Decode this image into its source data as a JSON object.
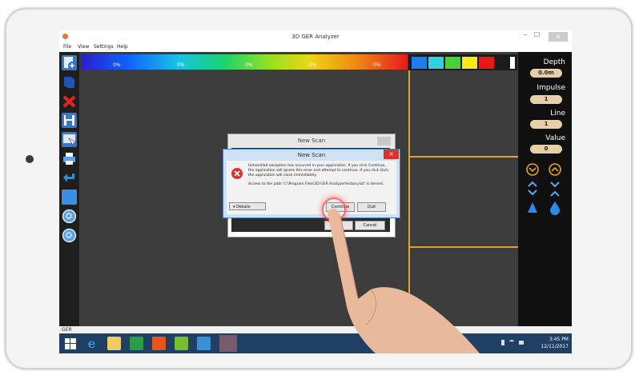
{
  "window": {
    "title": "3D GER Analyzer",
    "minimize": "–",
    "maximize": "☐",
    "close": "✕"
  },
  "menu": [
    "File",
    "View",
    "Settings",
    "Help"
  ],
  "colorbar": {
    "labels": [
      "0%",
      "0%",
      "0%",
      "0%",
      "0%"
    ]
  },
  "swatches": [
    "#1a7df0",
    "#2fd3df",
    "#45d03c",
    "#f7e91c",
    "#e81818",
    "#ffffff"
  ],
  "right_panel": {
    "depth_label": "Depth",
    "depth_value": "0.0m",
    "impulse_label": "Impulse",
    "impulse_value": "1",
    "line_label": "Line",
    "line_value": "1",
    "value_label": "Value",
    "value_value": "0"
  },
  "dialog_back": {
    "title": "New Scan",
    "cancel": "Cancel"
  },
  "dialog_front": {
    "title": "New Scan",
    "message1": "Unhandled exception has occurred in your application. If you click Continue, the application will ignore this error and attempt to continue. If you click Quit, the application will close immediately.",
    "message2": "Access to the path 'C:\\Program Files\\3D GER Analyzer\\history.txt' is denied.",
    "details": "Details",
    "continue": "Continue",
    "quit": "Quit"
  },
  "status": {
    "text": "GER"
  },
  "clock": {
    "time": "3:45 PM",
    "date": "12/11/2017"
  },
  "colors": {
    "accent": "#e2a32a",
    "taskbar": "#1f3f63",
    "error": "#d9342b"
  }
}
